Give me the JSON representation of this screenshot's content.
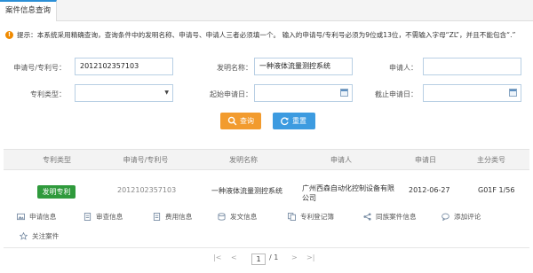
{
  "tab": {
    "label": "案件信息查询"
  },
  "tip": {
    "text": "提示：本系统采用精确查询，查询条件中的发明名称、申请号、申请人三者必须填一个。 输入的申请号/专利号必须为9位或13位，不需输入字母“ZL”，并且不能包含“.”"
  },
  "form": {
    "app_no_label": "申请号/专利号：",
    "app_no_value": "2012102357103",
    "invention_name_label": "发明名称：",
    "invention_name_value": "一种液体流量测控系统",
    "applicant_label": "申请人：",
    "applicant_value": "",
    "patent_type_label": "专利类型：",
    "patent_type_value": "",
    "start_date_label": "起始申请日：",
    "start_date_value": "",
    "end_date_label": "截止申请日：",
    "end_date_value": ""
  },
  "buttons": {
    "search": "查询",
    "reset": "重置"
  },
  "table": {
    "headers": [
      "专利类型",
      "申请号/专利号",
      "发明名称",
      "申请人",
      "申请日",
      "主分类号"
    ],
    "row": {
      "type": "发明专利",
      "app_no": "2012102357103",
      "name": "一种液体流量测控系统",
      "applicant": "广州西森自动化控制设备有限公司",
      "date": "2012-06-27",
      "ipc": "G01F 1/56"
    },
    "actions": [
      "申请信息",
      "审查信息",
      "费用信息",
      "发文信息",
      "专利登记簿",
      "同族案件信息",
      "添加评论",
      "关注案件"
    ]
  },
  "pager": {
    "first": "|<",
    "prev": "<",
    "page": "1",
    "total": "/ 1",
    "next": ">",
    "last": ">|"
  },
  "colors": {
    "accent": "#2b8fd6",
    "search_btn": "#f29b2e",
    "reset_btn": "#3d9be0",
    "badge": "#2f9a3c",
    "tip_icon": "#f08a00"
  }
}
